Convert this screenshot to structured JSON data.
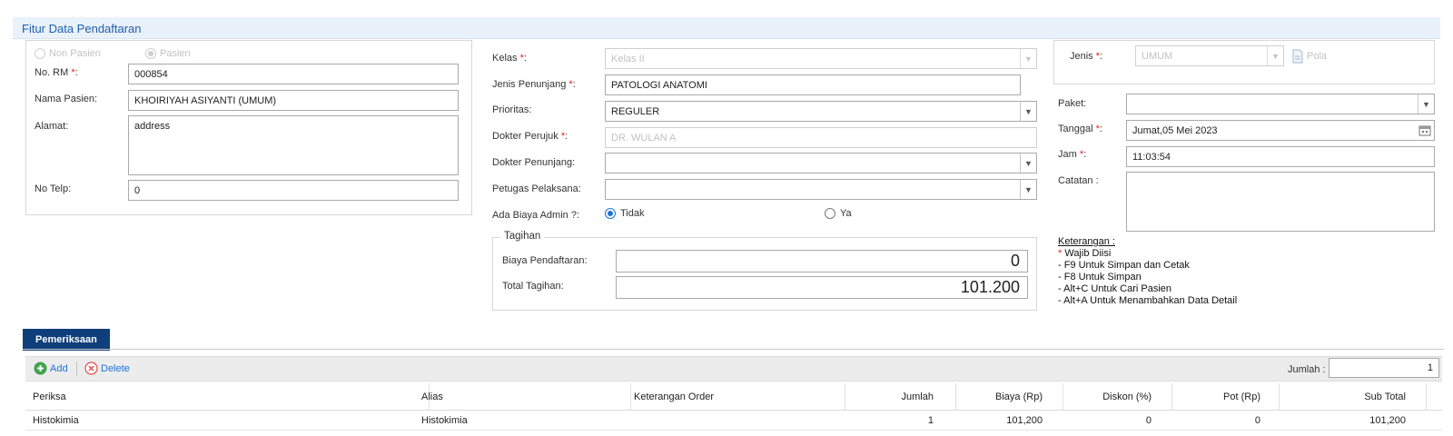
{
  "title": "Fitur Data Pendaftaran",
  "patient": {
    "type_non_pasien": "Non Pasien",
    "type_pasien": "Pasien",
    "no_rm_label": "No. RM",
    "no_rm_value": "000854",
    "nama_label": "Nama Pasien:",
    "nama_value": "KHOIRIYAH ASIYANTI (UMUM)",
    "alamat_label": "Alamat:",
    "alamat_value": "address",
    "telp_label": "No Telp:",
    "telp_value": "0"
  },
  "middle": {
    "kelas_label": "Kelas",
    "kelas_value": "Kelas II",
    "jenis_penunjang_label": "Jenis Penunjang",
    "jenis_penunjang_value": "PATOLOGI ANATOMI",
    "prioritas_label": "Prioritas:",
    "prioritas_value": "REGULER",
    "dokter_perujuk_label": "Dokter Perujuk",
    "dokter_perujuk_value": "DR. WULAN A",
    "dokter_penunjang_label": "Dokter Penunjang:",
    "dokter_penunjang_value": "",
    "petugas_label": "Petugas Pelaksana:",
    "petugas_value": "",
    "admin_label": "Ada Biaya Admin ?:",
    "admin_tidak": "Tidak",
    "admin_ya": "Ya",
    "tagihan_legend": "Tagihan",
    "biaya_label": "Biaya Pendaftaran:",
    "biaya_value": "0",
    "total_label": "Total Tagihan:",
    "total_value": "101.200"
  },
  "right": {
    "jenis_label": "Jenis",
    "jenis_value": "UMUM",
    "pola_label": "Pola",
    "paket_label": "Paket:",
    "paket_value": "",
    "tanggal_label": "Tanggal",
    "tanggal_value": "Jumat,05 Mei 2023",
    "jam_label": "Jam",
    "jam_value": "11:03:54",
    "catatan_label": "Catatan :",
    "catatan_value": "",
    "keterangan_title": "Keterangan :",
    "keterangan_star": "*",
    "keterangan_items": [
      "Wajib Diisi",
      "- F9 Untuk Simpan dan Cetak",
      "- F8 Untuk Simpan",
      "- Alt+C Untuk Cari Pasien",
      "- Alt+A Untuk Menambahkan Data Detail"
    ]
  },
  "req_mark": "*",
  "colon": ":",
  "pemeriksaan": {
    "tab_label": "Pemeriksaan",
    "add_label": "Add",
    "delete_label": "Delete",
    "jumlah_label": "Jumlah :",
    "jumlah_value": "1",
    "columns": [
      "Periksa",
      "Alias",
      "Keterangan Order",
      "Jumlah",
      "Biaya (Rp)",
      "Diskon (%)",
      "Pot (Rp)",
      "Sub Total"
    ],
    "rows": [
      [
        "Histokimia",
        "Histokimia",
        "",
        "1",
        "101,200",
        "0",
        "0",
        "101,200"
      ]
    ]
  },
  "colors": {
    "accent": "#1e73d8",
    "tab_bg": "#0f3f7a",
    "title_text": "#1f5fa8",
    "required": "#e02020"
  },
  "icons": [
    "chevron-down-icon",
    "calendar-icon",
    "pola-document-icon",
    "add-circle-icon",
    "delete-circle-icon"
  ]
}
